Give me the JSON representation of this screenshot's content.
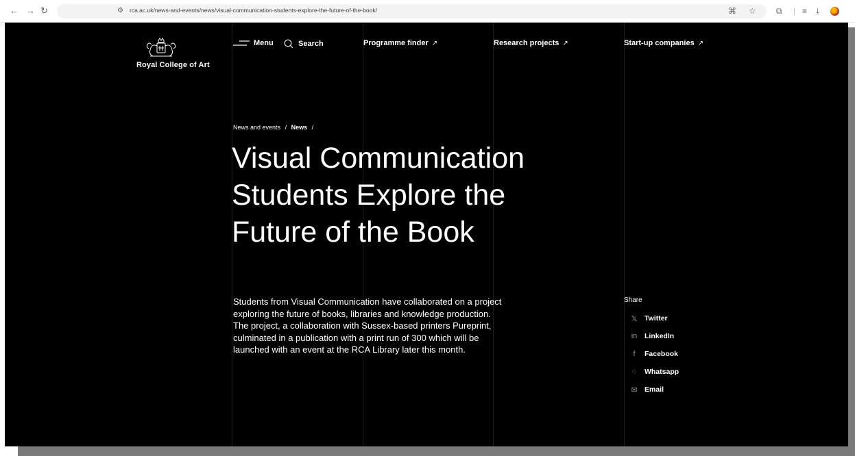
{
  "browser": {
    "url": "rca.ac.uk/news-and-events/news/visual-communication-students-explore-the-future-of-the-book/",
    "icons": [
      "back-icon",
      "forward-icon",
      "reload-icon",
      "site-info-icon",
      "translate-icon",
      "bookmark-star-icon",
      "extensions-icon",
      "reading-list-icon",
      "download-icon",
      "profile-icon"
    ]
  },
  "site": {
    "logo_text": "Royal College of Art"
  },
  "nav": {
    "menu_label": "Menu",
    "search_label": "Search",
    "programme_finder": "Programme finder",
    "research_projects": "Research projects",
    "startup_companies": "Start-up companies",
    "external_arrow": "↗"
  },
  "breadcrumb": {
    "items": [
      "News and events",
      "News"
    ],
    "separator": "/"
  },
  "article": {
    "title": "Visual Communication Students Explore the Future of the Book",
    "intro": "Students from Visual Communication have collaborated on a project exploring the future of books, libraries and knowledge production. The project, a collaboration with Sussex-based printers Pureprint, culminated in a publication with a print run of 300 which will be launched with an event at the RCA Library later this month."
  },
  "share": {
    "heading": "Share",
    "items": [
      {
        "label": "Twitter",
        "icon": "x-twitter-icon",
        "glyph": "𝕏"
      },
      {
        "label": "LinkedIn",
        "icon": "linkedin-icon",
        "glyph": "in"
      },
      {
        "label": "Facebook",
        "icon": "facebook-icon",
        "glyph": "f"
      },
      {
        "label": "Whatsapp",
        "icon": "whatsapp-icon",
        "glyph": "◌"
      },
      {
        "label": "Email",
        "icon": "email-icon",
        "glyph": "✉"
      }
    ]
  },
  "colors": {
    "page_background": "#000000",
    "text": "#ffffff",
    "guide_lines": "#1e1e1e"
  }
}
